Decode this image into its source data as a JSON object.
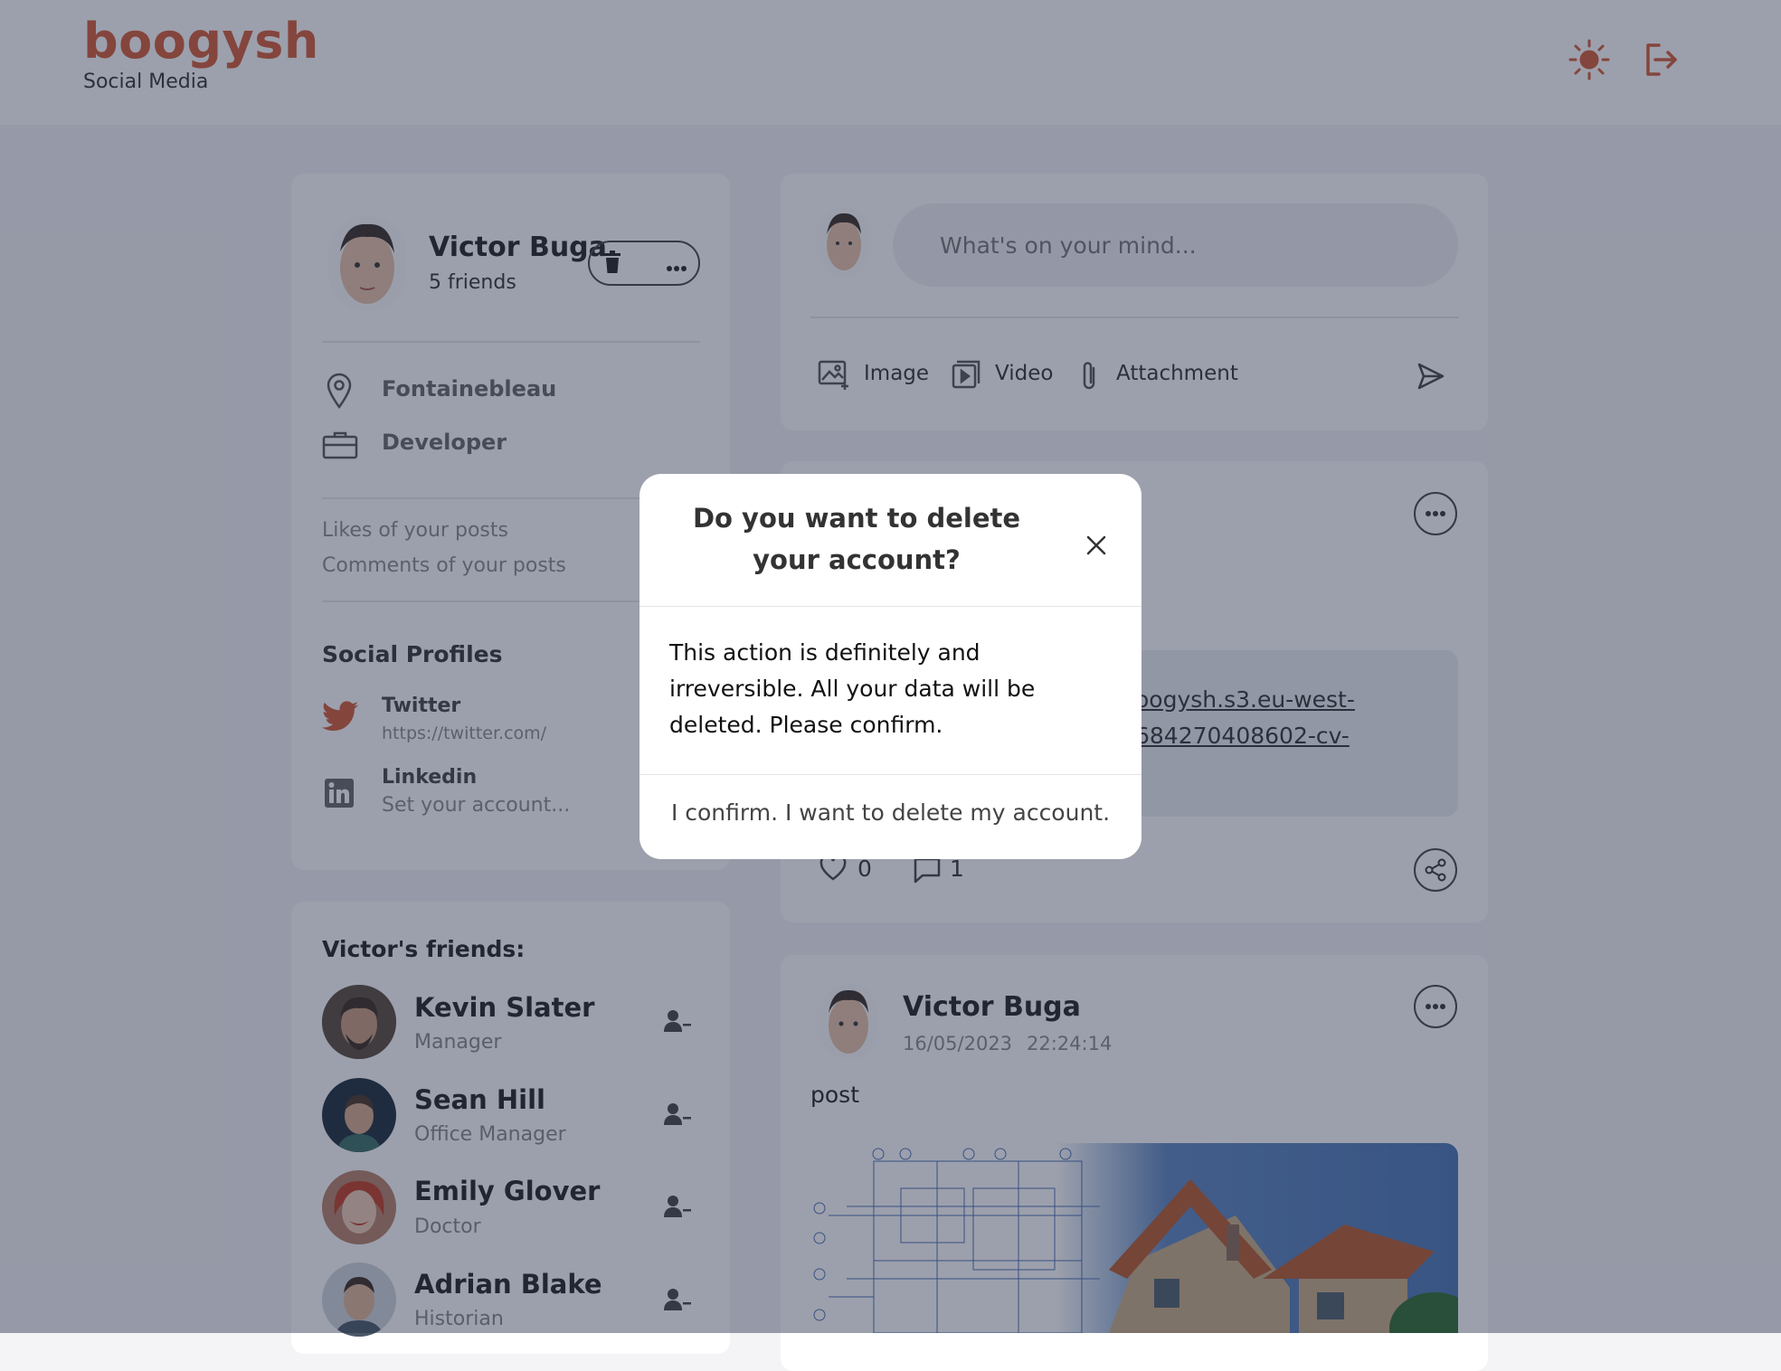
{
  "brand": {
    "name": "boogysh",
    "subtitle": "Social Media"
  },
  "header": {
    "icons": [
      "sun-icon",
      "logout-icon"
    ]
  },
  "colors": {
    "accent": "#d35a35",
    "overlay": "rgba(35,45,70,0.45)"
  },
  "profile": {
    "name": "Victor Buga",
    "friends_count": "5 friends",
    "location": "Fontainebleau",
    "occupation": "Developer",
    "stats": [
      "Likes of your posts",
      "Comments of your posts"
    ],
    "social_title": "Social Profiles",
    "social": [
      {
        "name": "Twitter",
        "value": "https://twitter.com/"
      },
      {
        "name": "Linkedin",
        "value": "Set your account..."
      }
    ]
  },
  "friends": {
    "title": "Victor's friends:",
    "items": [
      {
        "name": "Kevin Slater",
        "role": "Manager"
      },
      {
        "name": "Sean Hill",
        "role": "Office Manager"
      },
      {
        "name": "Emily Glover",
        "role": "Doctor"
      },
      {
        "name": "Adrian Blake",
        "role": "Historian"
      }
    ]
  },
  "composer": {
    "placeholder": "What's on your mind...",
    "actions": [
      {
        "label": "Image",
        "icon": "image-add-icon"
      },
      {
        "label": "Video",
        "icon": "video-icon"
      },
      {
        "label": "Attachment",
        "icon": "paperclip-icon"
      }
    ]
  },
  "post1": {
    "link_line1": "oogysh.s3.eu-west-",
    "link_line2": "684270408602-cv-",
    "likes": "0",
    "comments": "1"
  },
  "post2": {
    "author": "Victor Buga",
    "date": "16/05/2023",
    "time": "22:24:14",
    "text": "post"
  },
  "modal": {
    "title": "Do you want to delete your account?",
    "body": "This action is definitely and irreversible. All your data will be deleted. Please confirm.",
    "confirm": "I confirm. I want to delete my account."
  }
}
